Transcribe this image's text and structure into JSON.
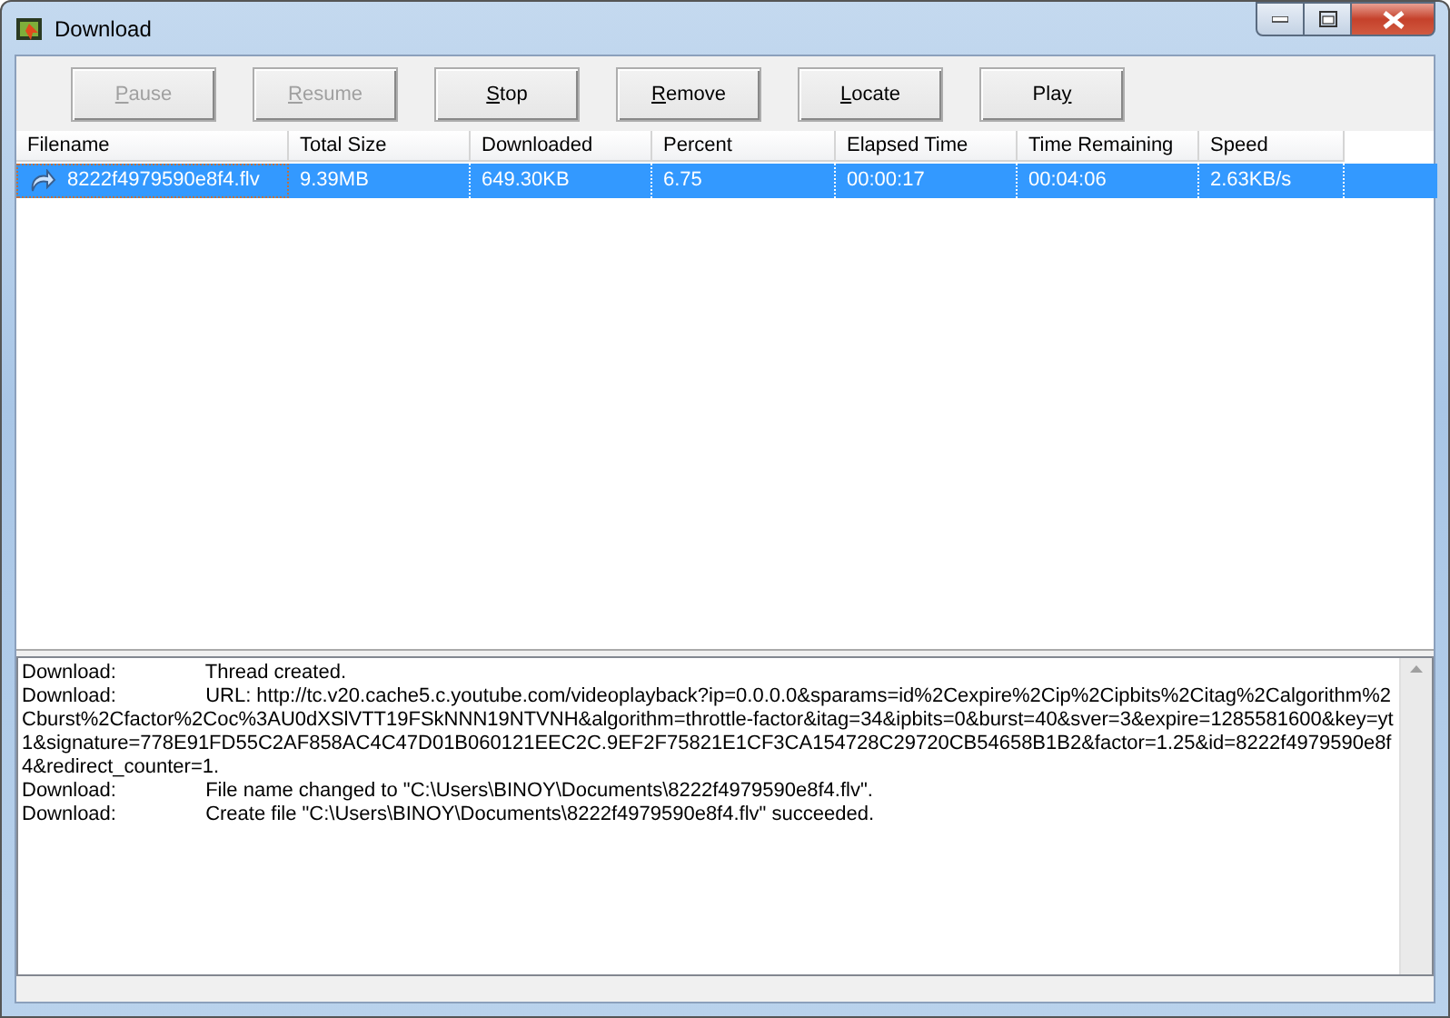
{
  "window": {
    "title": "Download"
  },
  "toolbar": [
    {
      "key": "P",
      "post": "ause",
      "disabled": true
    },
    {
      "key": "R",
      "post": "esume",
      "disabled": true
    },
    {
      "key": "S",
      "post": "top",
      "disabled": false
    },
    {
      "key": "R",
      "post": "emove",
      "disabled": false
    },
    {
      "key": "L",
      "post": "ocate",
      "disabled": false
    },
    {
      "pre": "Pla",
      "key": "y",
      "disabled": false
    }
  ],
  "table": {
    "columns": [
      "Filename",
      "Total Size",
      "Downloaded",
      "Percent",
      "Elapsed Time",
      "Time Remaining",
      "Speed"
    ],
    "rows": [
      {
        "selected": true,
        "cells": [
          "8222f4979590e8f4.flv",
          "9.39MB",
          "649.30KB",
          "6.75",
          "00:00:17",
          "00:04:06",
          "2.63KB/s"
        ]
      }
    ]
  },
  "log": [
    {
      "source": "Download:",
      "message": "Thread created."
    },
    {
      "source": "Download:",
      "message": "URL: http://tc.v20.cache5.c.youtube.com/videoplayback?ip=0.0.0.0&sparams=id%2Cexpire%2Cip%2Cipbits%2Citag%2Calgorithm%2Cburst%2Cfactor%2Coc%3AU0dXSlVTT19FSkNNN19NTVNH&algorithm=throttle-factor&itag=34&ipbits=0&burst=40&sver=3&expire=1285581600&key=yt1&signature=778E91FD55C2AF858AC4C47D01B060121EEC2C.9EF2F75821E1CF3CA154728C29720CB54658B1B2&factor=1.25&id=8222f4979590e8f4&redirect_counter=1."
    },
    {
      "source": "Download:",
      "message": "File name changed to \"C:\\Users\\BINOY\\Documents\\8222f4979590e8f4.flv\"."
    },
    {
      "source": "Download:",
      "message": "Create file \"C:\\Users\\BINOY\\Documents\\8222f4979590e8f4.flv\" succeeded."
    }
  ]
}
